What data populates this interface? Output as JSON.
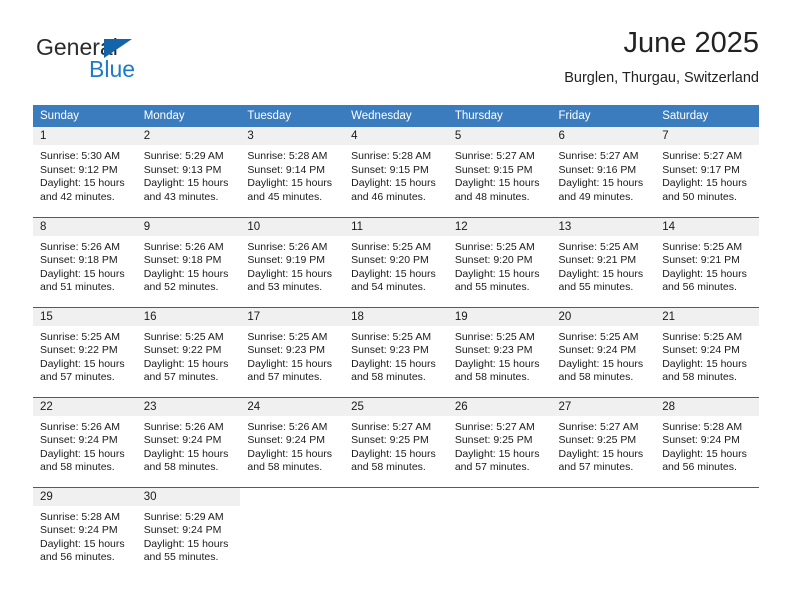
{
  "logo": {
    "word_one": "General",
    "word_two": "Blue",
    "triangle_color": "#1464aa",
    "blue_color": "#1e7bc8"
  },
  "header": {
    "title": "June 2025",
    "subtitle": "Burglen, Thurgau, Switzerland"
  },
  "colors": {
    "header_blue": "#3a7cbe",
    "row_divider_blue": "#2467a8",
    "daynum_band": "#f0f0f0"
  },
  "weekday_headers": [
    "Sunday",
    "Monday",
    "Tuesday",
    "Wednesday",
    "Thursday",
    "Friday",
    "Saturday"
  ],
  "weeks": [
    [
      {
        "day": "1",
        "sunrise": "Sunrise: 5:30 AM",
        "sunset": "Sunset: 9:12 PM",
        "daylight_1": "Daylight: 15 hours",
        "daylight_2": "and 42 minutes."
      },
      {
        "day": "2",
        "sunrise": "Sunrise: 5:29 AM",
        "sunset": "Sunset: 9:13 PM",
        "daylight_1": "Daylight: 15 hours",
        "daylight_2": "and 43 minutes."
      },
      {
        "day": "3",
        "sunrise": "Sunrise: 5:28 AM",
        "sunset": "Sunset: 9:14 PM",
        "daylight_1": "Daylight: 15 hours",
        "daylight_2": "and 45 minutes."
      },
      {
        "day": "4",
        "sunrise": "Sunrise: 5:28 AM",
        "sunset": "Sunset: 9:15 PM",
        "daylight_1": "Daylight: 15 hours",
        "daylight_2": "and 46 minutes."
      },
      {
        "day": "5",
        "sunrise": "Sunrise: 5:27 AM",
        "sunset": "Sunset: 9:15 PM",
        "daylight_1": "Daylight: 15 hours",
        "daylight_2": "and 48 minutes."
      },
      {
        "day": "6",
        "sunrise": "Sunrise: 5:27 AM",
        "sunset": "Sunset: 9:16 PM",
        "daylight_1": "Daylight: 15 hours",
        "daylight_2": "and 49 minutes."
      },
      {
        "day": "7",
        "sunrise": "Sunrise: 5:27 AM",
        "sunset": "Sunset: 9:17 PM",
        "daylight_1": "Daylight: 15 hours",
        "daylight_2": "and 50 minutes."
      }
    ],
    [
      {
        "day": "8",
        "sunrise": "Sunrise: 5:26 AM",
        "sunset": "Sunset: 9:18 PM",
        "daylight_1": "Daylight: 15 hours",
        "daylight_2": "and 51 minutes."
      },
      {
        "day": "9",
        "sunrise": "Sunrise: 5:26 AM",
        "sunset": "Sunset: 9:18 PM",
        "daylight_1": "Daylight: 15 hours",
        "daylight_2": "and 52 minutes."
      },
      {
        "day": "10",
        "sunrise": "Sunrise: 5:26 AM",
        "sunset": "Sunset: 9:19 PM",
        "daylight_1": "Daylight: 15 hours",
        "daylight_2": "and 53 minutes."
      },
      {
        "day": "11",
        "sunrise": "Sunrise: 5:25 AM",
        "sunset": "Sunset: 9:20 PM",
        "daylight_1": "Daylight: 15 hours",
        "daylight_2": "and 54 minutes."
      },
      {
        "day": "12",
        "sunrise": "Sunrise: 5:25 AM",
        "sunset": "Sunset: 9:20 PM",
        "daylight_1": "Daylight: 15 hours",
        "daylight_2": "and 55 minutes."
      },
      {
        "day": "13",
        "sunrise": "Sunrise: 5:25 AM",
        "sunset": "Sunset: 9:21 PM",
        "daylight_1": "Daylight: 15 hours",
        "daylight_2": "and 55 minutes."
      },
      {
        "day": "14",
        "sunrise": "Sunrise: 5:25 AM",
        "sunset": "Sunset: 9:21 PM",
        "daylight_1": "Daylight: 15 hours",
        "daylight_2": "and 56 minutes."
      }
    ],
    [
      {
        "day": "15",
        "sunrise": "Sunrise: 5:25 AM",
        "sunset": "Sunset: 9:22 PM",
        "daylight_1": "Daylight: 15 hours",
        "daylight_2": "and 57 minutes."
      },
      {
        "day": "16",
        "sunrise": "Sunrise: 5:25 AM",
        "sunset": "Sunset: 9:22 PM",
        "daylight_1": "Daylight: 15 hours",
        "daylight_2": "and 57 minutes."
      },
      {
        "day": "17",
        "sunrise": "Sunrise: 5:25 AM",
        "sunset": "Sunset: 9:23 PM",
        "daylight_1": "Daylight: 15 hours",
        "daylight_2": "and 57 minutes."
      },
      {
        "day": "18",
        "sunrise": "Sunrise: 5:25 AM",
        "sunset": "Sunset: 9:23 PM",
        "daylight_1": "Daylight: 15 hours",
        "daylight_2": "and 58 minutes."
      },
      {
        "day": "19",
        "sunrise": "Sunrise: 5:25 AM",
        "sunset": "Sunset: 9:23 PM",
        "daylight_1": "Daylight: 15 hours",
        "daylight_2": "and 58 minutes."
      },
      {
        "day": "20",
        "sunrise": "Sunrise: 5:25 AM",
        "sunset": "Sunset: 9:24 PM",
        "daylight_1": "Daylight: 15 hours",
        "daylight_2": "and 58 minutes."
      },
      {
        "day": "21",
        "sunrise": "Sunrise: 5:25 AM",
        "sunset": "Sunset: 9:24 PM",
        "daylight_1": "Daylight: 15 hours",
        "daylight_2": "and 58 minutes."
      }
    ],
    [
      {
        "day": "22",
        "sunrise": "Sunrise: 5:26 AM",
        "sunset": "Sunset: 9:24 PM",
        "daylight_1": "Daylight: 15 hours",
        "daylight_2": "and 58 minutes."
      },
      {
        "day": "23",
        "sunrise": "Sunrise: 5:26 AM",
        "sunset": "Sunset: 9:24 PM",
        "daylight_1": "Daylight: 15 hours",
        "daylight_2": "and 58 minutes."
      },
      {
        "day": "24",
        "sunrise": "Sunrise: 5:26 AM",
        "sunset": "Sunset: 9:24 PM",
        "daylight_1": "Daylight: 15 hours",
        "daylight_2": "and 58 minutes."
      },
      {
        "day": "25",
        "sunrise": "Sunrise: 5:27 AM",
        "sunset": "Sunset: 9:25 PM",
        "daylight_1": "Daylight: 15 hours",
        "daylight_2": "and 58 minutes."
      },
      {
        "day": "26",
        "sunrise": "Sunrise: 5:27 AM",
        "sunset": "Sunset: 9:25 PM",
        "daylight_1": "Daylight: 15 hours",
        "daylight_2": "and 57 minutes."
      },
      {
        "day": "27",
        "sunrise": "Sunrise: 5:27 AM",
        "sunset": "Sunset: 9:25 PM",
        "daylight_1": "Daylight: 15 hours",
        "daylight_2": "and 57 minutes."
      },
      {
        "day": "28",
        "sunrise": "Sunrise: 5:28 AM",
        "sunset": "Sunset: 9:24 PM",
        "daylight_1": "Daylight: 15 hours",
        "daylight_2": "and 56 minutes."
      }
    ],
    [
      {
        "day": "29",
        "sunrise": "Sunrise: 5:28 AM",
        "sunset": "Sunset: 9:24 PM",
        "daylight_1": "Daylight: 15 hours",
        "daylight_2": "and 56 minutes."
      },
      {
        "day": "30",
        "sunrise": "Sunrise: 5:29 AM",
        "sunset": "Sunset: 9:24 PM",
        "daylight_1": "Daylight: 15 hours",
        "daylight_2": "and 55 minutes."
      },
      {
        "day": "",
        "sunrise": "",
        "sunset": "",
        "daylight_1": "",
        "daylight_2": ""
      },
      {
        "day": "",
        "sunrise": "",
        "sunset": "",
        "daylight_1": "",
        "daylight_2": ""
      },
      {
        "day": "",
        "sunrise": "",
        "sunset": "",
        "daylight_1": "",
        "daylight_2": ""
      },
      {
        "day": "",
        "sunrise": "",
        "sunset": "",
        "daylight_1": "",
        "daylight_2": ""
      },
      {
        "day": "",
        "sunrise": "",
        "sunset": "",
        "daylight_1": "",
        "daylight_2": ""
      }
    ]
  ]
}
